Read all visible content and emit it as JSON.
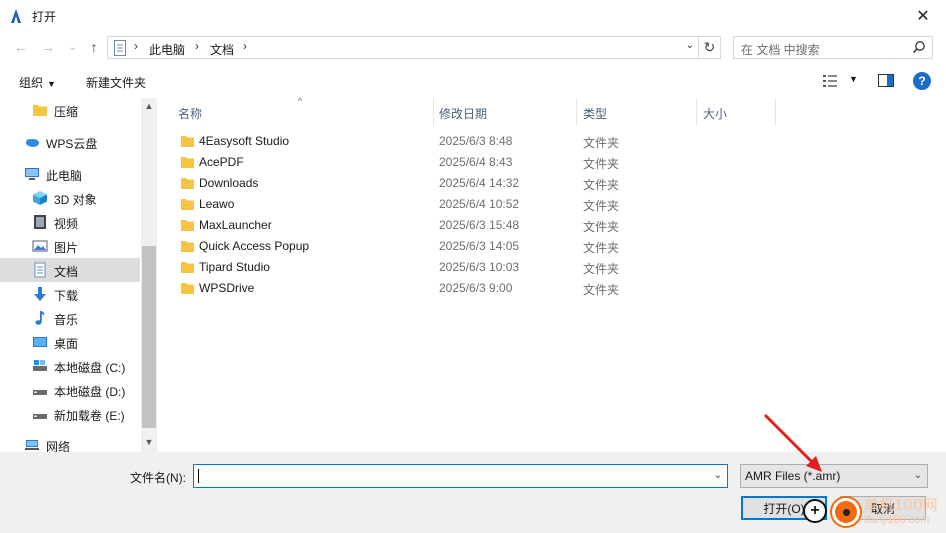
{
  "window": {
    "title": "打开",
    "close_glyph": "✕"
  },
  "nav": {
    "back_glyph": "←",
    "forward_glyph": "→",
    "recent_glyph": "⌄",
    "up_glyph": "↑",
    "breadcrumb": [
      "此电脑",
      "文档"
    ],
    "sep": "›",
    "refresh_glyph": "↻",
    "search_placeholder": "在 文档 中搜索"
  },
  "toolbar": {
    "organize": "组织",
    "new_folder": "新建文件夹",
    "help": "?"
  },
  "sidebar": {
    "items": [
      {
        "label": "压缩",
        "icon": "folder-icon"
      },
      {
        "label": "WPS云盘",
        "icon": "cloud-icon"
      },
      {
        "label": "此电脑",
        "icon": "computer-icon"
      },
      {
        "label": "3D 对象",
        "icon": "cube-icon"
      },
      {
        "label": "视频",
        "icon": "video-icon"
      },
      {
        "label": "图片",
        "icon": "picture-icon"
      },
      {
        "label": "文档",
        "icon": "document-icon",
        "selected": true
      },
      {
        "label": "下载",
        "icon": "download-icon"
      },
      {
        "label": "音乐",
        "icon": "music-icon"
      },
      {
        "label": "桌面",
        "icon": "desktop-icon"
      },
      {
        "label": "本地磁盘 (C:)",
        "icon": "drive-icon"
      },
      {
        "label": "本地磁盘 (D:)",
        "icon": "drive-icon"
      },
      {
        "label": "新加载卷 (E:)",
        "icon": "drive-icon"
      },
      {
        "label": "网络",
        "icon": "network-icon"
      }
    ]
  },
  "file_list": {
    "columns": [
      "名称",
      "修改日期",
      "类型",
      "大小"
    ],
    "rows": [
      {
        "name": "4Easysoft Studio",
        "date": "2025/6/3 8:48",
        "type": "文件夹"
      },
      {
        "name": "AcePDF",
        "date": "2025/6/4 8:43",
        "type": "文件夹"
      },
      {
        "name": "Downloads",
        "date": "2025/6/4 14:32",
        "type": "文件夹"
      },
      {
        "name": "Leawo",
        "date": "2025/6/4 10:52",
        "type": "文件夹"
      },
      {
        "name": "MaxLauncher",
        "date": "2025/6/3 15:48",
        "type": "文件夹"
      },
      {
        "name": "Quick Access Popup",
        "date": "2025/6/3 14:05",
        "type": "文件夹"
      },
      {
        "name": "Tipard Studio",
        "date": "2025/6/3 10:03",
        "type": "文件夹"
      },
      {
        "name": "WPSDrive",
        "date": "2025/6/3 9:00",
        "type": "文件夹"
      }
    ]
  },
  "footer": {
    "filename_label": "文件名(N):",
    "filename_value": "",
    "filetype_value": "AMR Files (*.amr)",
    "open_button": "打开(O)",
    "cancel_button": "取消"
  },
  "watermark": {
    "site_cn": "单机100网",
    "site_url": "danji100.com"
  },
  "colors": {
    "accent": "#0078d7",
    "annotation_arrow": "#e02020",
    "watermark": "#f26b0f"
  }
}
